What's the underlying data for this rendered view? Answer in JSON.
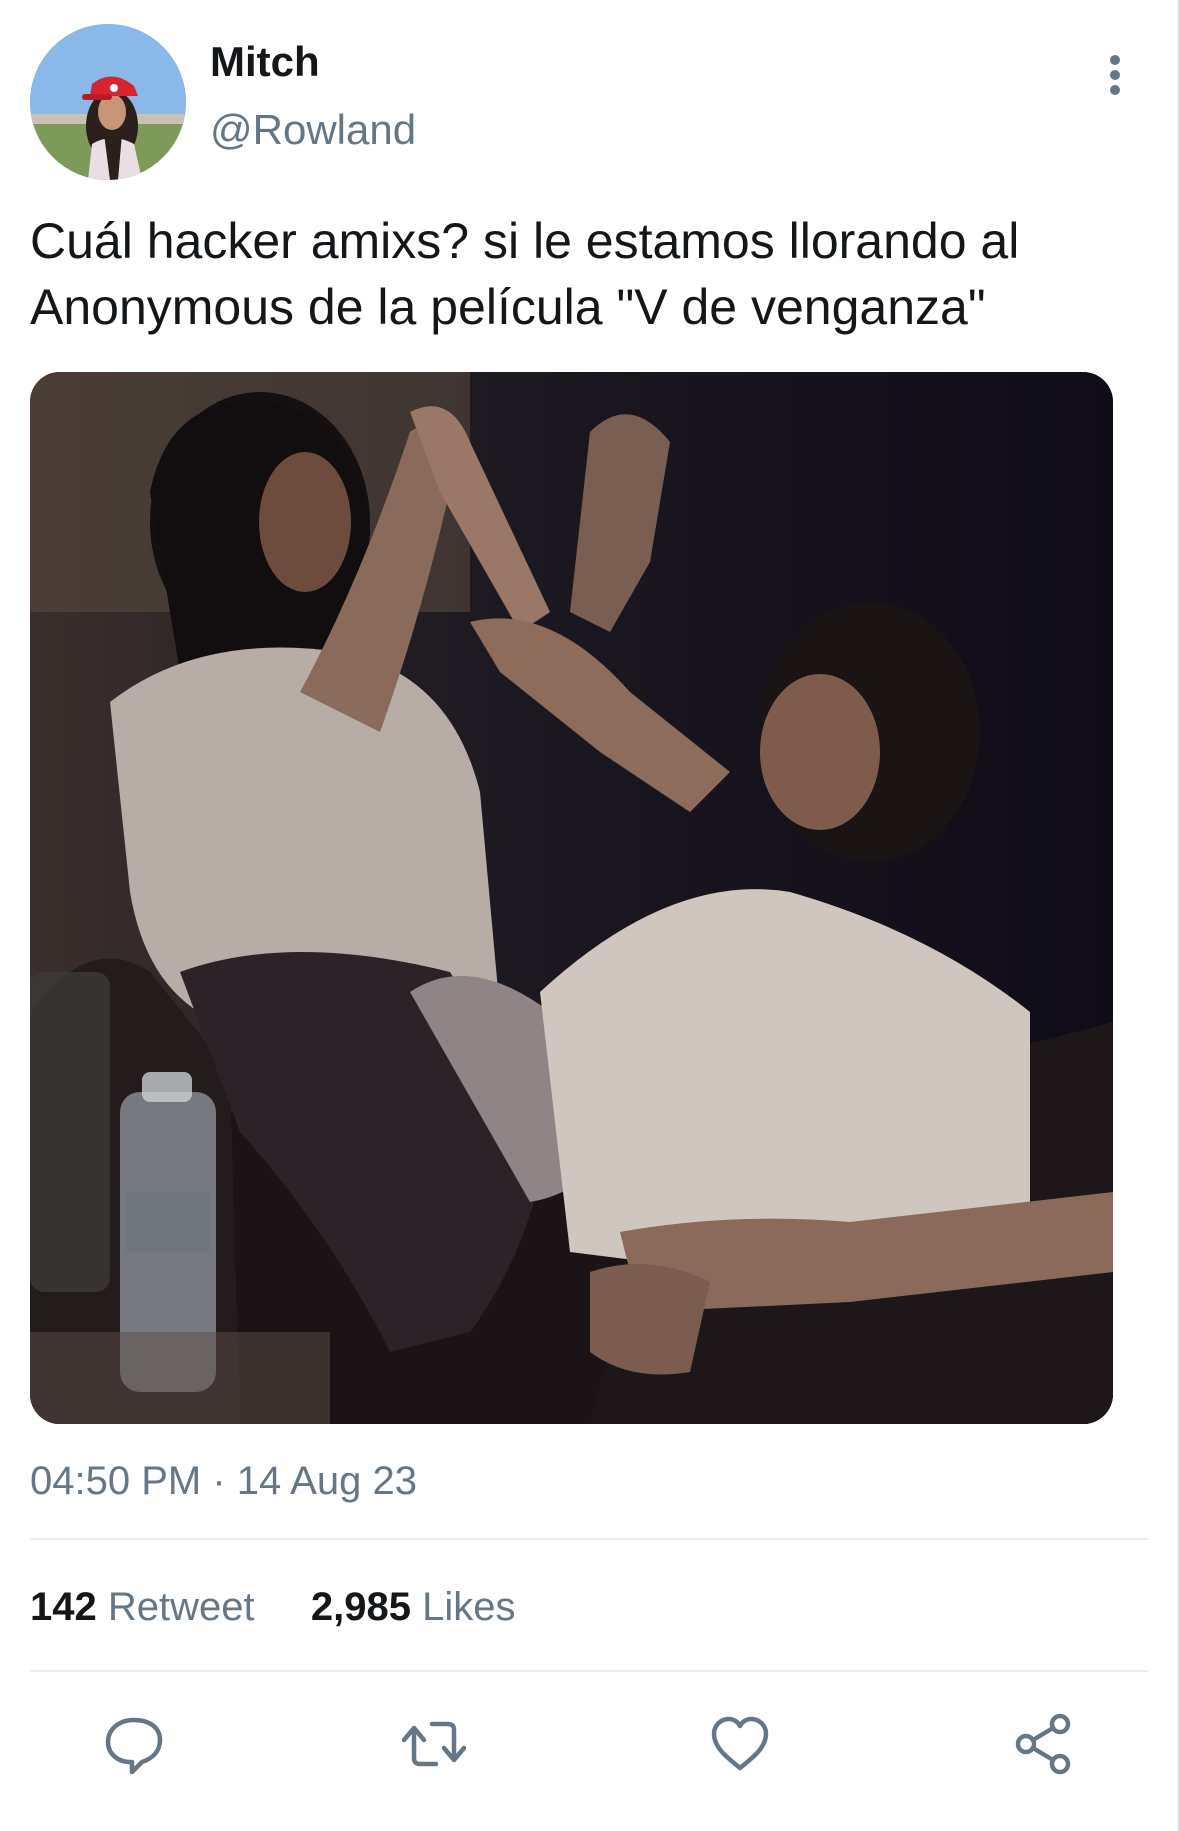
{
  "tweet": {
    "author": {
      "display_name": "Mitch",
      "handle": "@Rowland"
    },
    "text": "Cuál hacker amixs? si le estamos llorando al Anonymous de la película \"V de venganza\"",
    "timestamp": "04:50 PM · 14 Aug 23",
    "stats": {
      "retweet_count": "142",
      "retweet_label": "Retweet",
      "like_count": "2,985",
      "like_label": "Likes"
    }
  },
  "icons": {
    "more": "more-vertical-icon",
    "reply": "reply-icon",
    "retweet": "retweet-icon",
    "like": "heart-icon",
    "share": "share-icon"
  },
  "colors": {
    "primary_text": "#14171a",
    "secondary_text": "#657786",
    "divider": "#e6ecf0",
    "icon": "#657786"
  }
}
